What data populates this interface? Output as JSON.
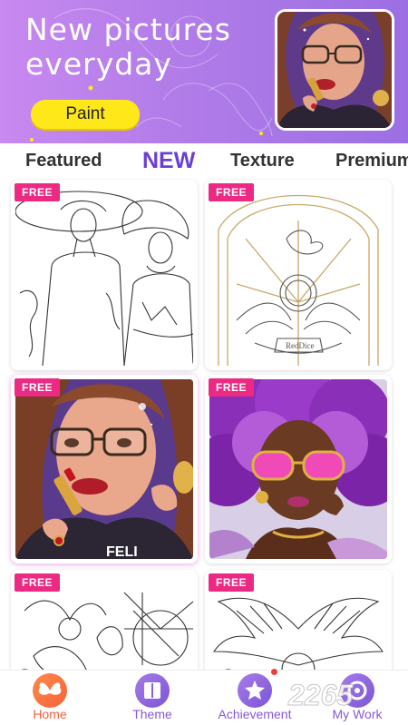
{
  "banner": {
    "title": "New pictures everyday",
    "paint_label": "Paint"
  },
  "tabs": [
    {
      "label": "Featured",
      "active": false
    },
    {
      "label": "NEW",
      "active": true
    },
    {
      "label": "Texture",
      "active": false
    },
    {
      "label": "Premium",
      "active": false
    }
  ],
  "cards": [
    {
      "badge": "FREE",
      "style": "line-art",
      "subject": "two women in hats"
    },
    {
      "badge": "FREE",
      "style": "line-art",
      "subject": "angel with dove"
    },
    {
      "badge": "FREE",
      "style": "colored",
      "subject": "woman with lipstick"
    },
    {
      "badge": "FREE",
      "style": "colored",
      "subject": "woman with pink glasses"
    },
    {
      "badge": "FREE",
      "style": "line-art",
      "subject": "flowers"
    },
    {
      "badge": "FREE",
      "style": "line-art",
      "subject": "wings"
    }
  ],
  "nav": [
    {
      "label": "Home",
      "icon": "butterfly-icon",
      "active": true
    },
    {
      "label": "Theme",
      "icon": "book-icon",
      "active": false
    },
    {
      "label": "Achievement",
      "icon": "medal-icon",
      "active": false
    },
    {
      "label": "My Work",
      "icon": "palette-icon",
      "active": false
    }
  ],
  "watermark": "2265",
  "colors": {
    "accent": "#6b3fd6",
    "badge": "#ec2a84",
    "paint_button": "#ffe81a",
    "home_active": "#f5623a"
  }
}
